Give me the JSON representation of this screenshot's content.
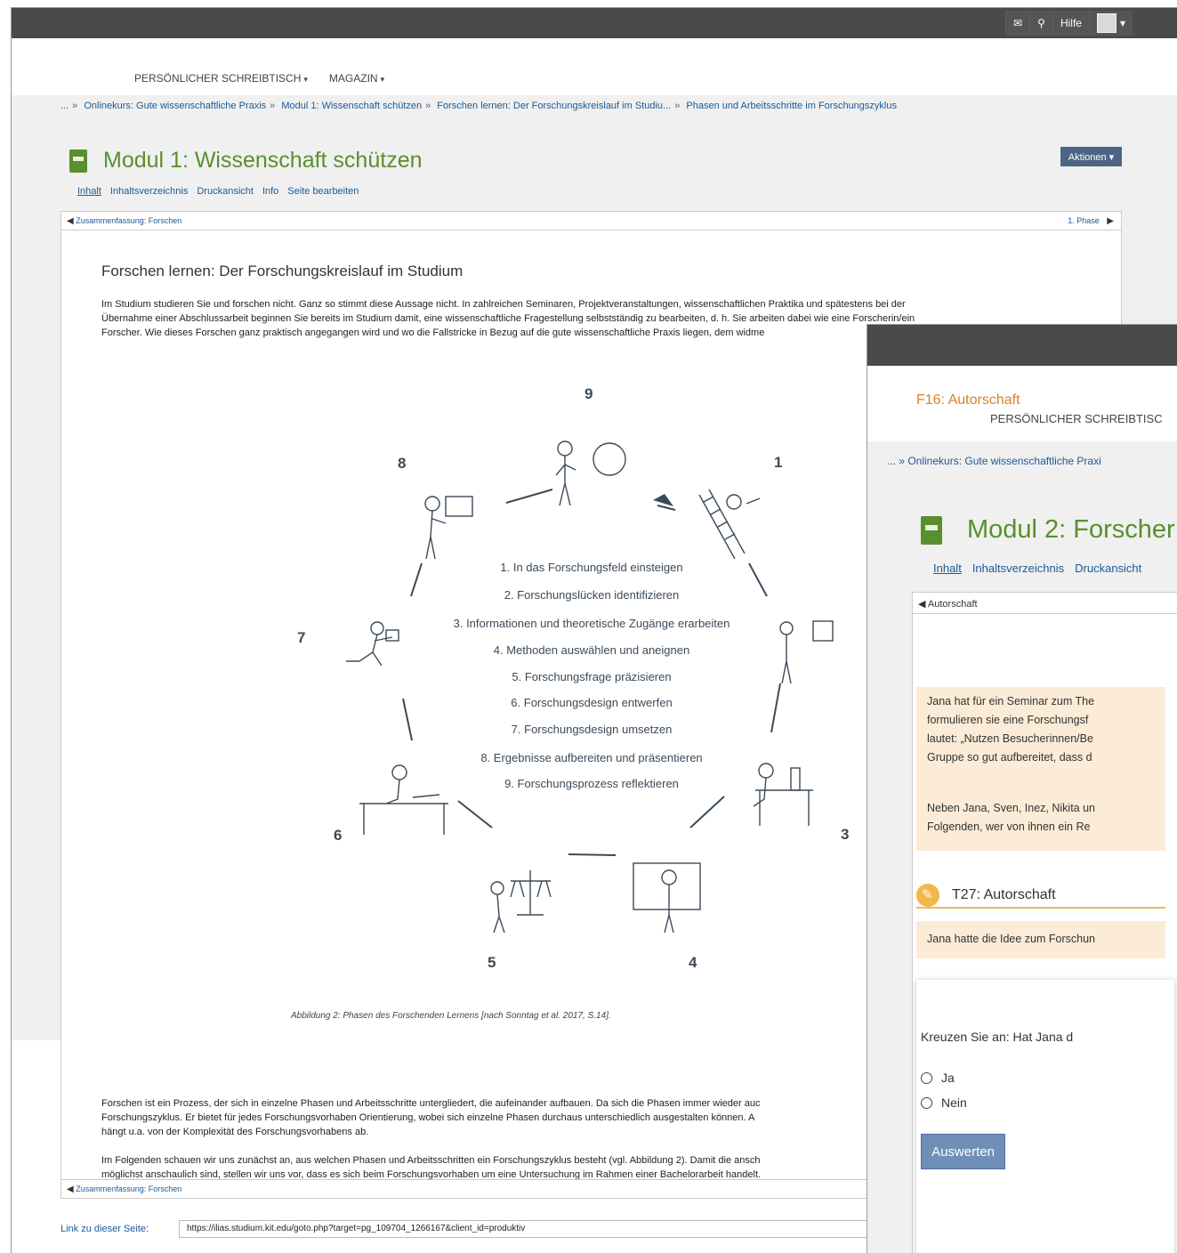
{
  "window1": {
    "topbar": {
      "mail_icon": "envelope-icon",
      "search_icon": "search-icon",
      "help": "Hilfe",
      "caret": "▾"
    },
    "nav": {
      "item1": "PERSÖNLICHER SCHREIBTISCH",
      "item2": "MAGAZIN",
      "caret": "▾"
    },
    "breadcrumbs": [
      "...",
      "Onlinekurs: Gute wissenschaftliche Praxis",
      "Modul 1: Wissenschaft schützen",
      "Forschen lernen: Der Forschungskreislauf im Studiu...",
      "Phasen und Arbeitsschritte im Forschungszyklus"
    ],
    "crumb_sep": "»",
    "title": "Modul 1: Wissenschaft schützen",
    "actions_button": "Aktionen ▾",
    "tabs": [
      "Inhalt",
      "Inhaltsverzeichnis",
      "Druckansicht",
      "Info",
      "Seite bearbeiten"
    ],
    "prev_link": "Zusammenfassung: Forschen",
    "next_link": "1. Phase",
    "heading": "Forschen lernen: Der Forschungskreislauf im Studium",
    "intro": [
      "Im Studium studieren Sie und forschen nicht. Ganz so stimmt diese Aussage nicht. In zahlreichen Seminaren, Projektveranstaltungen, wissenschaftlichen Praktika und spätestens bei der",
      "Übernahme einer Abschlussarbeit beginnen Sie bereits im Studium damit, eine wissenschaftliche Fragestellung selbstständig zu bearbeiten, d. h. Sie arbeiten dabei wie eine Forscherin/ein",
      "Forscher. Wie dieses Forschen ganz praktisch angegangen wird und wo die Fallstricke in Bezug auf die gute wissenschaftliche Praxis liegen, dem widme"
    ],
    "cycle_numbers": [
      "9",
      "1",
      "2",
      "3",
      "4",
      "5",
      "6",
      "7",
      "8"
    ],
    "steps": [
      "1. In das Forschungsfeld einsteigen",
      "2. Forschungslücken identifizieren",
      "3. Informationen und theoretische Zugänge erarbeiten",
      "4. Methoden auswählen und aneignen",
      "5. Forschungsfrage präzisieren",
      "6. Forschungsdesign entwerfen",
      "7. Forschungsdesign umsetzen",
      "8. Ergebnisse aufbereiten und präsentieren",
      "9. Forschungsprozess reflektieren"
    ],
    "caption": "Abbildung 2: Phasen des Forschenden Lernens [nach Sonntag et al. 2017, S.14].",
    "para2": [
      "Forschen ist ein Prozess, der sich in einzelne Phasen und Arbeitsschritte untergliedert, die aufeinander aufbauen. Da sich die Phasen immer wieder auc",
      "Forschungszyklus. Er bietet für jedes Forschungsvorhaben Orientierung, wobei sich einzelne Phasen durchaus unterschiedlich ausgestalten können. A",
      "hängt u.a. von der Komplexität des Forschungsvorhabens ab."
    ],
    "para3": [
      "Im Folgenden schauen wir uns zunächst an, aus welchen Phasen und Arbeitsschritten ein Forschungszyklus besteht (vgl. Abbildung 2). Damit die ansch",
      "möglichst anschaulich sind, stellen wir uns vor, dass es sich beim Forschungsvorhaben um eine Untersuchung im Rahmen einer Bachelorarbeit handelt."
    ],
    "link_label": "Link zu dieser Seite:",
    "link_url": "https://ilias.studium.kit.edu/goto.php?target=pg_109704_1266167&client_id=produktiv"
  },
  "window2": {
    "nav_item": "PERSÖNLICHER SCHREIBTISC",
    "breadcrumb": "... » Onlinekurs: Gute wissenschaftliche Praxi",
    "title": "Modul 2: Forscher",
    "tabs": [
      "Inhalt",
      "Inhaltsverzeichnis",
      "Druckansicht"
    ],
    "prev_link": "Autorschaft",
    "f16_title": "F16: Autorschaft",
    "box1": [
      "Jana hat für ein Seminar zum The",
      "formulieren sie eine Forschungsf",
      "lautet: „Nutzen Besucherinnen/Be",
      "Gruppe so gut aufbereitet, dass d"
    ],
    "box1b": [
      "Neben Jana, Sven, Inez, Nikita un",
      "Folgenden, wer von ihnen ein Re"
    ],
    "t27_title": "T27: Autorschaft",
    "box2": "Jana hatte die Idee zum Forschun",
    "question": "Kreuzen Sie an: Hat Jana d",
    "options": [
      "Ja",
      "Nein"
    ],
    "submit": "Auswerten"
  },
  "colors": {
    "topbar": "#4a4a4a",
    "title_green": "#5a8f2d",
    "link_blue": "#1a5a96",
    "orange": "#d9822b",
    "button_blue": "#4c6586"
  }
}
